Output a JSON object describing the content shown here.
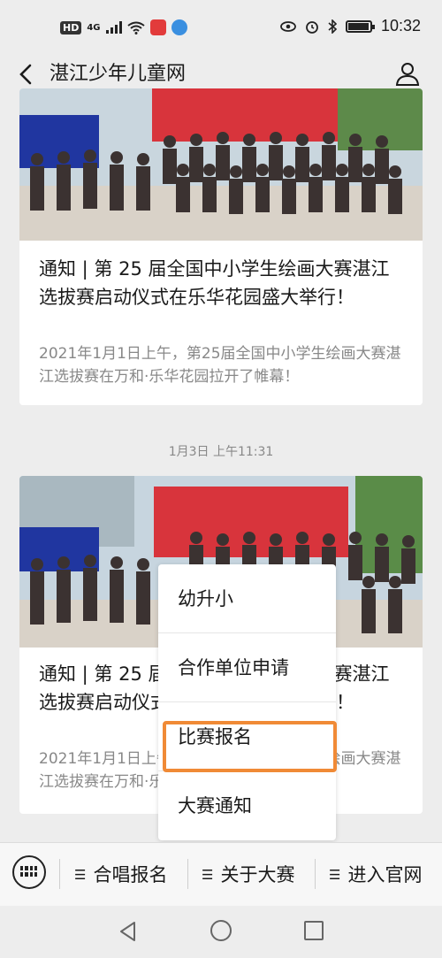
{
  "status_bar": {
    "hd": "HD",
    "network": "4G",
    "time": "10:32",
    "battery_level": 0.9,
    "icons": [
      "signal-icon",
      "wifi-icon",
      "app-badge-icon",
      "app-icon",
      "eye-icon",
      "alarm-icon",
      "bluetooth-icon",
      "battery-icon"
    ]
  },
  "titlebar": {
    "title": "湛江少年儿童网",
    "back_icon": "chevron-left-icon",
    "profile_icon": "user-icon"
  },
  "messages": [
    {
      "title": "通知 | 第 25 届全国中小学生绘画大赛湛江选拔赛启动仪式在乐华花园盛大举行！",
      "desc": "2021年1月1日上午，第25届全国中小学生绘画大赛湛江选拔赛在万和·乐华花园拉开了帷幕！"
    },
    {
      "title": "通知 | 第 25 届全国中小学生绘画大赛湛江选拔赛启动仪式在乐华花园盛大举行！",
      "desc": "2021年1月1日上午，第25届全国中小学生绘画大赛湛江选拔赛在万和·乐华花园拉开了帷幕！"
    }
  ],
  "timestamp": "1月3日 上午11:31",
  "popup_menu": {
    "items": [
      "幼升小",
      "合作单位申请",
      "比赛报名",
      "大赛通知"
    ],
    "highlighted_index": 2
  },
  "bottom_menu": {
    "keyboard_icon": "keyboard-icon",
    "items": [
      "合唱报名",
      "关于大赛",
      "进入官网"
    ]
  },
  "colors": {
    "background": "#ededed",
    "highlight": "#f08a36",
    "banner_red": "#d8343c"
  }
}
